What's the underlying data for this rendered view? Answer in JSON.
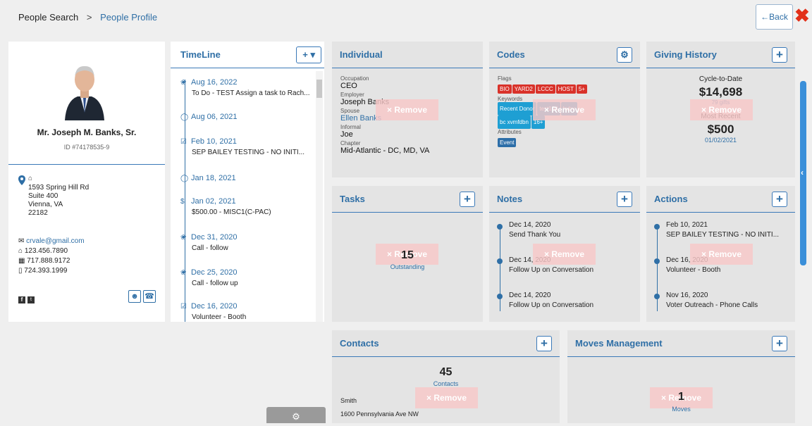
{
  "breadcrumb": {
    "root": "People Search",
    "sep": ">",
    "current": "People Profile"
  },
  "back_label": "←Back",
  "close_glyph": "✖",
  "remove_label": "× Remove",
  "profile": {
    "name": "Mr. Joseph M. Banks, Sr.",
    "id": "ID #74178535-9",
    "address": [
      "1593 Spring Hill Rd",
      "Suite 400",
      "Vienna, VA",
      "22182"
    ],
    "email": "crvale@gmail.com",
    "home_phone": "123.456.7890",
    "work_phone": "717.888.9172",
    "mobile_phone": "724.393.1999"
  },
  "timeline": {
    "title": "TimeLine",
    "add": "+ ▾",
    "items": [
      {
        "date": "Aug 16, 2022",
        "desc": "To Do - TEST Assign a task to Rach..."
      },
      {
        "date": "Aug 06, 2021",
        "desc": ""
      },
      {
        "date": "Feb 10, 2021",
        "desc": "SEP BAILEY TESTING - NO INITI..."
      },
      {
        "date": "Jan 18, 2021",
        "desc": ""
      },
      {
        "date": "Jan 02, 2021",
        "desc": "$500.00 - MISC1(C-PAC)"
      },
      {
        "date": "Dec 31, 2020",
        "desc": "Call - follow"
      },
      {
        "date": "Dec 25, 2020",
        "desc": "Call - follow up"
      },
      {
        "date": "Dec 16, 2020",
        "desc": "Volunteer - Booth"
      }
    ]
  },
  "individual": {
    "title": "Individual",
    "occupation_label": "Occupation",
    "occupation": "CEO",
    "employer_label": "Employer",
    "employer": "Joseph Banks",
    "spouse_label": "Spouse",
    "spouse": "Ellen Banks",
    "informal_label": "Informal",
    "informal": "Joe",
    "chapter_label": "Chapter",
    "chapter": "Mid-Atlantic - DC, MD, VA"
  },
  "codes": {
    "title": "Codes",
    "flags_label": "Flags",
    "flags": [
      "BIO",
      "YARD2",
      "LCCC",
      "HOST",
      "5+"
    ],
    "keywords_label": "Keywords",
    "keywords": [
      "Recent Donor",
      "test104",
      "hvbv",
      "bc xvmfdbn",
      "16+"
    ],
    "attributes_label": "Attributes",
    "attributes": [
      "Event"
    ]
  },
  "giving": {
    "title": "Giving History",
    "cycle_label": "Cycle-to-Date",
    "cycle_amount": "$14,698",
    "gifts": "79 gifts",
    "recent_label": "Most Recent",
    "recent_amount": "$500",
    "recent_date": "01/02/2021"
  },
  "tasks": {
    "title": "Tasks",
    "count": "15",
    "status": "Outstanding"
  },
  "notes": {
    "title": "Notes",
    "items": [
      {
        "date": "Dec 14, 2020",
        "desc": "Send Thank You"
      },
      {
        "date": "Dec 14, 2020",
        "desc": "Follow Up on Conversation"
      },
      {
        "date": "Dec 14, 2020",
        "desc": "Follow Up on Conversation"
      }
    ]
  },
  "actions": {
    "title": "Actions",
    "items": [
      {
        "date": "Feb 10, 2021",
        "desc": "SEP BAILEY TESTING - NO INITI..."
      },
      {
        "date": "Dec 16, 2020",
        "desc": "Volunteer - Booth"
      },
      {
        "date": "Nov 16, 2020",
        "desc": "Voter Outreach - Phone Calls"
      }
    ]
  },
  "contacts": {
    "title": "Contacts",
    "count": "45",
    "count_label": "Contacts",
    "name": "Smith",
    "address": "1600 Pennsylvania Ave NW"
  },
  "moves": {
    "title": "Moves Management",
    "count": "1",
    "count_label": "Moves"
  },
  "colors": {
    "accent": "#2f6fa6",
    "danger": "#e2301a",
    "tag_red": "#d9322a",
    "tag_blue": "#1e9fd3"
  }
}
